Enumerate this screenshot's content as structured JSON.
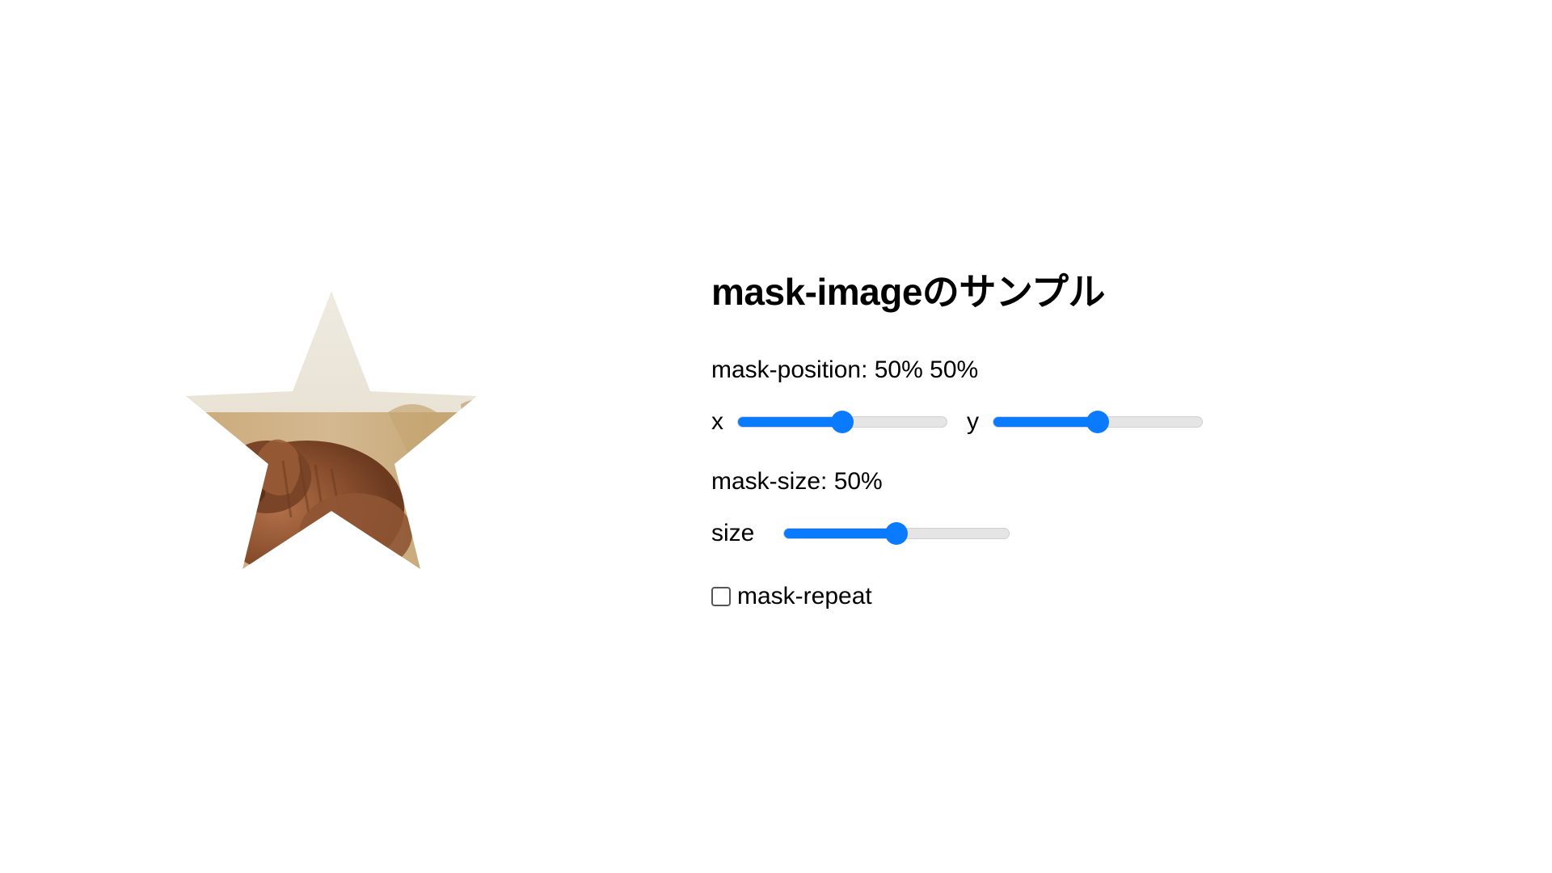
{
  "title": "mask-imageのサンプル",
  "maskPosition": {
    "labelPrefix": "mask-position: ",
    "valueText": "50% 50%",
    "xLabel": "x",
    "yLabel": "y",
    "xValue": 50,
    "yValue": 50
  },
  "maskSize": {
    "labelPrefix": "mask-size: ",
    "valueText": "50%",
    "sizeLabel": "size",
    "sizeValue": 50
  },
  "maskRepeat": {
    "label": "mask-repeat",
    "checked": false
  }
}
